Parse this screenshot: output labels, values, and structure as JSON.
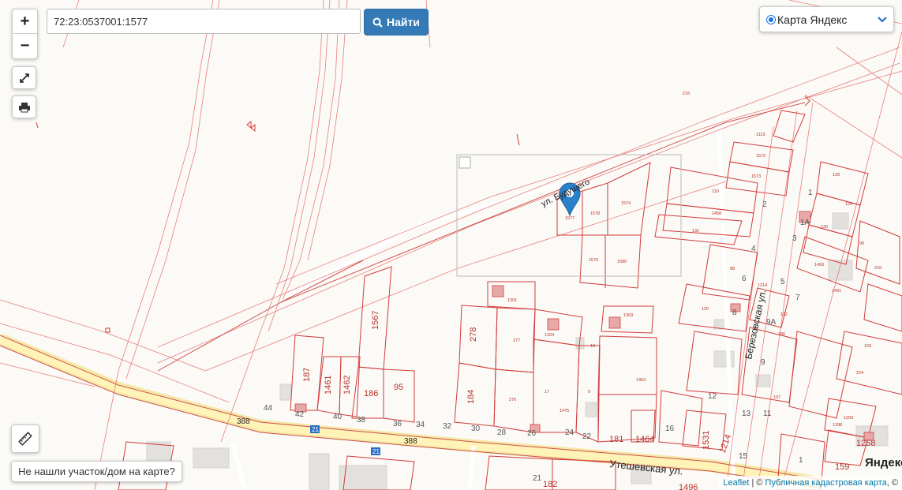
{
  "search": {
    "value": "72:23:0537001:1577",
    "button_label": "Найти"
  },
  "zoom": {
    "in_label": "+",
    "out_label": "−"
  },
  "layer_select": {
    "selected": "Карта Яндекс"
  },
  "not_found_button": "Не нашли участок/дом на карте?",
  "attribution": {
    "leaflet": "Leaflet",
    "separator": " | © ",
    "source": "Публичная кадастровая карта",
    "tail": ", ©"
  },
  "yandex_logo": "Яндекс",
  "map": {
    "streets": {
      "budushchego": "ул. Будущего",
      "berezovskaya": "Березовская ул.",
      "uteshevskaya": "Утешевская ул.",
      "road_no": "388",
      "road_no_2": "388"
    },
    "parcels_big": [
      "1567",
      "278",
      "184",
      "187",
      "1461",
      "1462",
      "186",
      "95",
      "1464",
      "1531",
      "1214",
      "1258",
      "159",
      "181",
      "182",
      "1496"
    ],
    "parcels_small": [
      "1577",
      "1578",
      "1574",
      "1576",
      "1580",
      "1301",
      "1303",
      "1304",
      "277",
      "276",
      "1475",
      "1463",
      "1119",
      "1572",
      "1573",
      "110",
      "1458",
      "131",
      "128",
      "129",
      "130",
      "90",
      "1490",
      "1491",
      "215",
      "169",
      "224",
      "216",
      "120",
      "112",
      "186",
      "107",
      "1259",
      "1298",
      "98",
      "1214",
      "17",
      "10",
      "9"
    ],
    "houses": [
      "44",
      "42",
      "40",
      "38",
      "36",
      "34",
      "32",
      "30",
      "28",
      "26",
      "24",
      "22",
      "16",
      "13",
      "11",
      "12",
      "15",
      "9",
      "9А",
      "8",
      "7",
      "6",
      "5",
      "4",
      "3",
      "2",
      "1",
      "1А",
      "21",
      "1"
    ],
    "route_badge": "21"
  },
  "icons": [
    "zoom-in-icon",
    "zoom-out-icon",
    "fullscreen-icon",
    "print-icon",
    "search-icon",
    "chevron-down-icon",
    "ruler-icon",
    "map-marker-icon"
  ]
}
